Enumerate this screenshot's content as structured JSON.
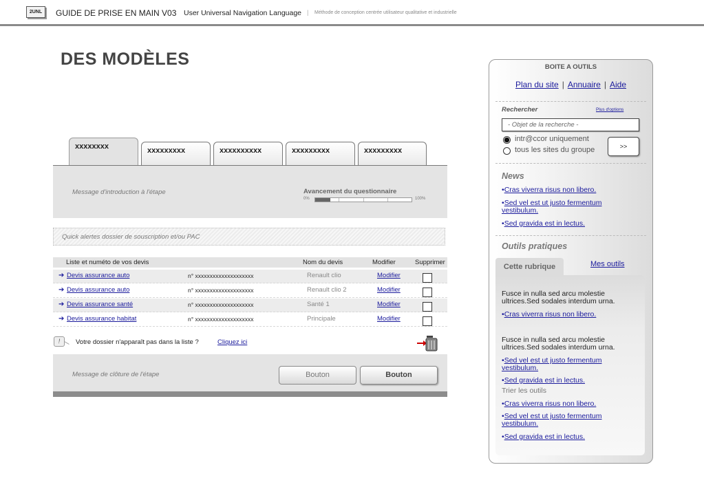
{
  "header": {
    "logo": "2UNL",
    "guide": "GUIDE DE PRISE EN MAIN V03",
    "unl": "User Universal Navigation Language",
    "separator": "|",
    "method": "Méthode de conception centrée utilisateur qualitative et industrielle"
  },
  "page_title": "DES MODÈLES",
  "tabs": [
    {
      "label": "xxxxxxxx",
      "active": true
    },
    {
      "label": "xxxxxxxxx",
      "active": false
    },
    {
      "label": "xxxxxxxxxx",
      "active": false
    },
    {
      "label": "xxxxxxxxx",
      "active": false
    },
    {
      "label": "xxxxxxxxx",
      "active": false
    }
  ],
  "intro": {
    "message": "Message d'introduction à l'étape",
    "progress_title": "Avancement du questionnaire",
    "progress_min": "0%",
    "progress_max": "100%",
    "progress_fraction": 0.16
  },
  "alerts": "Quick alertes dossier de souscription et/ou PAC",
  "devis": {
    "headers": {
      "list": "Liste et numéto de vos devis",
      "name": "Nom du devis",
      "modify": "Modifier",
      "delete": "Supprimer"
    },
    "rows": [
      {
        "title": "Devis assurance auto",
        "number": "n° xxxxxxxxxxxxxxxxxxxx",
        "name": "Renault clio",
        "action": "Modifier"
      },
      {
        "title": "Devis assurance auto",
        "number": "n° xxxxxxxxxxxxxxxxxxxx",
        "name": "Renault clio 2",
        "action": "Modifier"
      },
      {
        "title": "Devis assurance santé",
        "number": "n° xxxxxxxxxxxxxxxxxxxx",
        "name": "Santé 1",
        "action": "Modifier"
      },
      {
        "title": "Devis assurance habitat",
        "number": "n° xxxxxxxxxxxxxxxxxxxx",
        "name": "Principale",
        "action": "Modifier"
      }
    ],
    "missing_icon": "!",
    "missing_text": "Votre dossier n'apparaît pas dans la liste ?",
    "missing_link": "Cliquez ici"
  },
  "closing": {
    "message": "Message de clôture de l'étape",
    "button1": "Bouton",
    "button2": "Bouton"
  },
  "toolbox": {
    "title": "BOITE A OUTILS",
    "links": [
      "Plan du site",
      "Annuaire",
      "Aide"
    ],
    "pipe": "|",
    "search_label": "Rechercher",
    "more_options": "Plus d'options",
    "search_placeholder": "- Objet de la recherche -",
    "radio1": "intr@ccor uniquement",
    "radio2": "tous les sites du groupe",
    "go": ">>",
    "news_title": "News",
    "news": [
      "Cras viverra risus non libero.",
      "Sed vel est ut justo fermentum vestibulum.",
      "Sed gravida est in lectus."
    ],
    "tools_title": "Outils pratiques",
    "tab_active": "Cette rubrique",
    "tab_other": "Mes outils",
    "para1": "Fusce in nulla sed arcu molestie ultrices.Sed sodales interdum urna.",
    "link1": "Cras viverra risus non libero.",
    "para2": "Fusce in nulla sed arcu molestie ultrices.Sed sodales interdum urna.",
    "links2": [
      "Sed vel est ut justo fermentum vestibulum.",
      "Sed gravida est in lectus."
    ],
    "sort_label": "Trier les outils",
    "links3": [
      "Cras viverra risus non libero.",
      "Sed vel est ut justo fermentum vestibulum.",
      "Sed gravida est in lectus."
    ]
  },
  "bullet": "•",
  "colors": {
    "link": "#1a1a9c",
    "panel": "#e4e4e4",
    "bar": "#8c8c8c"
  },
  "icons": [
    "arrow-right-icon",
    "alert-icon",
    "trash-icon",
    "radio-icon"
  ]
}
